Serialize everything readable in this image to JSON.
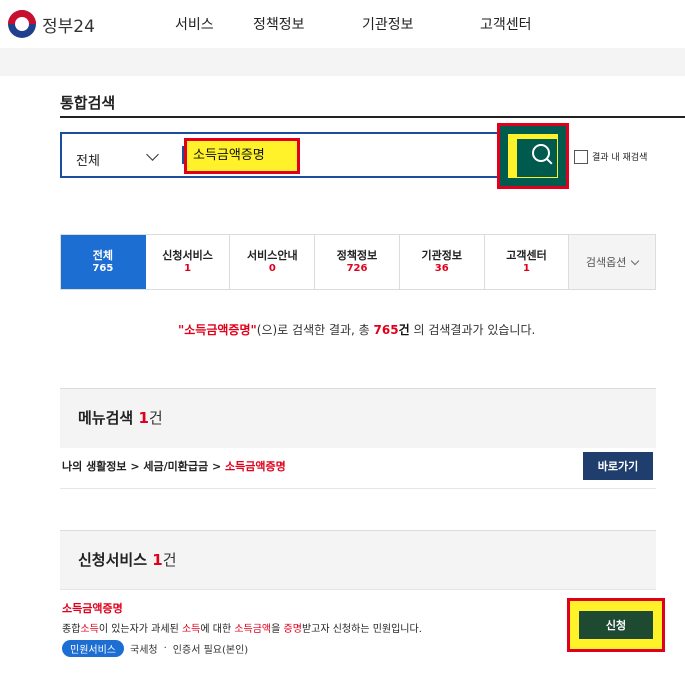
{
  "header": {
    "logo_text": "정부24",
    "nav": [
      "서비스",
      "정책정보",
      "기관정보",
      "고객센터"
    ]
  },
  "page_title": "통합검색",
  "search": {
    "scope": "전체",
    "query": "소득금액증명",
    "within_results_label": "결과 내 재검색"
  },
  "tabs": [
    {
      "label": "전체",
      "count": "765",
      "active": true
    },
    {
      "label": "신청서비스",
      "count": "1"
    },
    {
      "label": "서비스안내",
      "count": "0"
    },
    {
      "label": "정책정보",
      "count": "726"
    },
    {
      "label": "기관정보",
      "count": "36"
    },
    {
      "label": "고객센터",
      "count": "1"
    }
  ],
  "search_option_label": "검색옵션",
  "summary": {
    "q_open": "\"",
    "query": "소득금액증명",
    "q_close": "\"",
    "mid": "(으)로 검색한 결과, 총 ",
    "total": "765",
    "unit": "건",
    "tail": " 의 검색결과가 있습니다."
  },
  "menu_section": {
    "title": "메뉴검색",
    "count": "1",
    "unit": "건",
    "crumb_path": "나의 생활정보 > 세금/미환급금 > ",
    "crumb_target": "소득금액증명",
    "go_button": "바로가기"
  },
  "service_section": {
    "title": "신청서비스",
    "count": "1",
    "unit": "건",
    "item_name": "소득금액증명",
    "desc": {
      "p1": "종합",
      "h1": "소득",
      "p2": "이 있는자가 과세된 ",
      "h2": "소득",
      "p3": "에 대한 ",
      "h3": "소득금액",
      "p4": "을 ",
      "h4": "증명",
      "p5": "받고자 신청하는 민원입니다."
    },
    "pill": "민원서비스",
    "agency": "국세청",
    "sep": "·",
    "cert": "인증서 필요(본인)",
    "apply_button": "신청"
  },
  "colors": {
    "primary_blue": "#1c6ed3",
    "search_button_green": "#005a4e",
    "highlight_red": "#e0001b",
    "highlight_yellow": "#fff22a",
    "go_button_navy": "#1f3e6e"
  }
}
